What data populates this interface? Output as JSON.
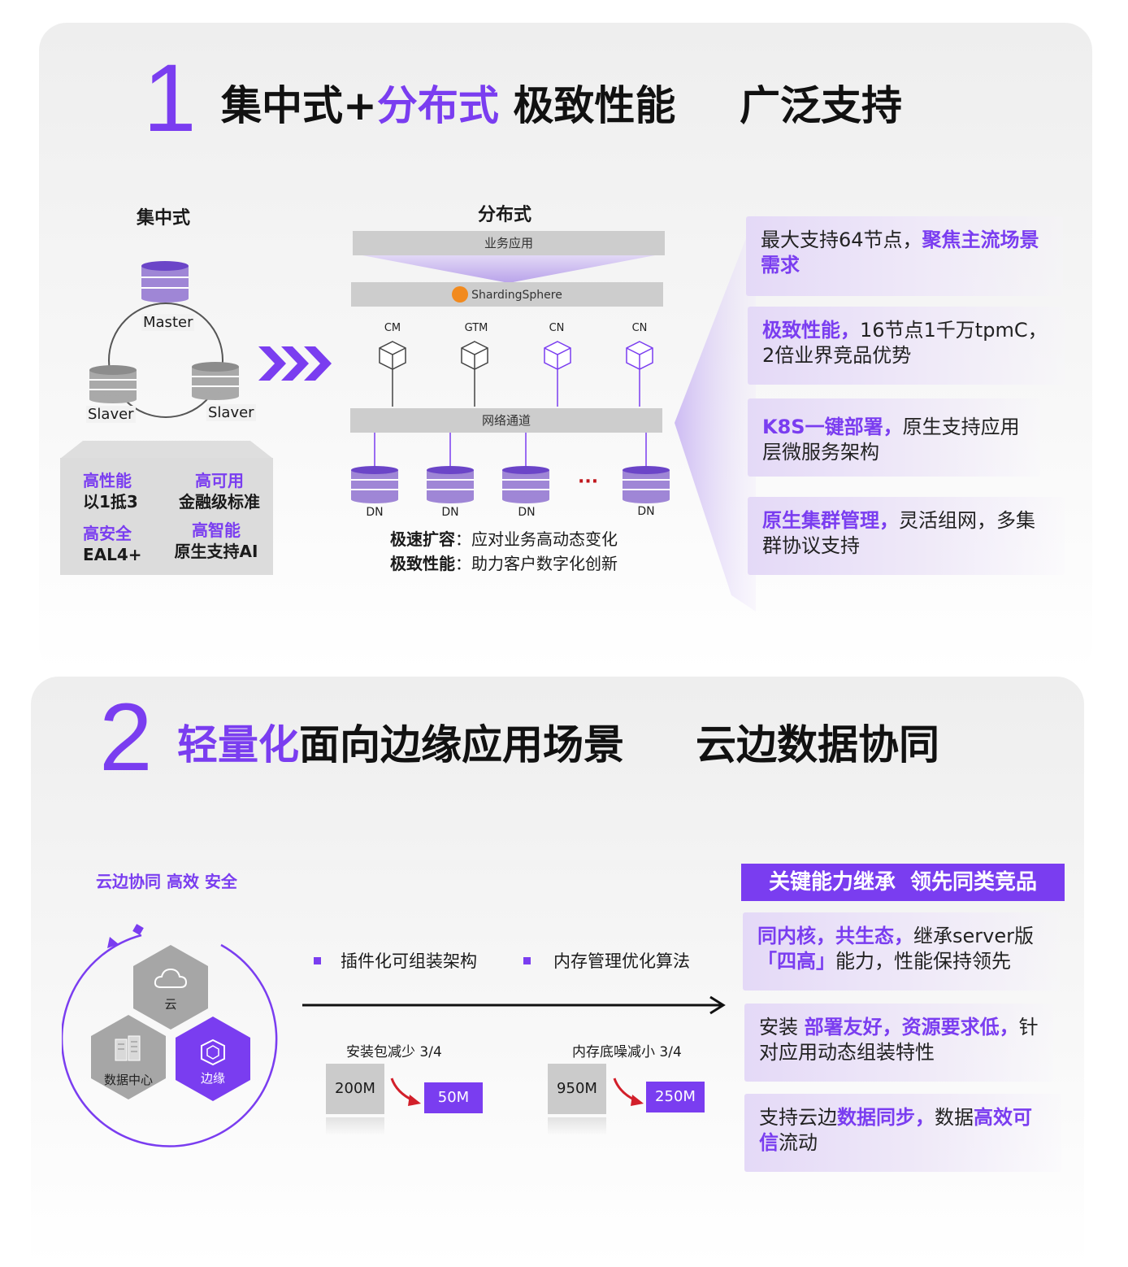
{
  "section1": {
    "number": "1",
    "title_part1": "集中式+",
    "title_part2": "分布式",
    "title_part3": " 极致性能",
    "title_part4": "广泛支持",
    "centralized": {
      "label": "集中式",
      "master": "Master",
      "slave_left": "Slaver",
      "slave_right": "Slaver",
      "features": [
        {
          "title": "高性能",
          "value": "以1抵3"
        },
        {
          "title": "高可用",
          "value": "金融级标准"
        },
        {
          "title": "高安全",
          "value": "EAL4+"
        },
        {
          "title": "高智能",
          "value": "原生支持AI"
        }
      ]
    },
    "distributed": {
      "label": "分布式",
      "app_bar": "业务应用",
      "sharding_bar": "ShardingSphere",
      "nodes": [
        "CM",
        "GTM",
        "CN",
        "CN"
      ],
      "network_bar": "网络通道",
      "dn_labels": [
        "DN",
        "DN",
        "DN",
        "DN"
      ],
      "ellipsis": "···",
      "notes": [
        {
          "key": "极速扩容",
          "value": "应对业务高动态变化"
        },
        {
          "key": "极致性能",
          "value": "助力客户数字化创新"
        }
      ]
    },
    "cards": [
      {
        "t1": "最大支持64节点，",
        "h1": "聚焦主流场景需求"
      },
      {
        "h1": "极致性能，",
        "t1": "16节点1千万tpmC，2倍业界竞品优势"
      },
      {
        "h1": "K8S一键部署，",
        "t1": "原生支持应用层微服务架构"
      },
      {
        "h1": "原生集群管理，",
        "t1": "灵活组网，多集群协议支持"
      }
    ]
  },
  "section2": {
    "number": "2",
    "title_part1": "轻量化",
    "title_part2": "面向边缘应用场景",
    "title_part3": "云边数据协同",
    "tagline": "云边协同 高效 安全",
    "hexes": {
      "cloud": "云",
      "datacenter": "数据中心",
      "edge": "边缘"
    },
    "bullets": [
      "插件化可组装架构",
      "内存管理优化算法"
    ],
    "install": {
      "caption": "安装包减少 3/4",
      "before": "200M",
      "after": "50M"
    },
    "memory": {
      "caption": "内存底噪减小 3/4",
      "before": "950M",
      "after": "250M"
    },
    "header": "关键能力继承  领先同类竞品",
    "cards": [
      {
        "h1": "同内核，共生态，",
        "t1": "继承server版",
        "h2": "「四高」",
        "t2": "能力，性能保持领先"
      },
      {
        "t1": "安装 ",
        "h1": "部署友好，资源要求低，",
        "t2": "针对应用动态组装特性"
      },
      {
        "t1": "支持云边",
        "h1": "数据同步，",
        "t2": "数据",
        "h2": "高效可信",
        "t3": "流动"
      }
    ]
  },
  "colors": {
    "accent": "#7a3df0",
    "db_top": "#6b45c8",
    "db_body": "#9f86d6",
    "gray_bar": "#cdcdcd"
  }
}
